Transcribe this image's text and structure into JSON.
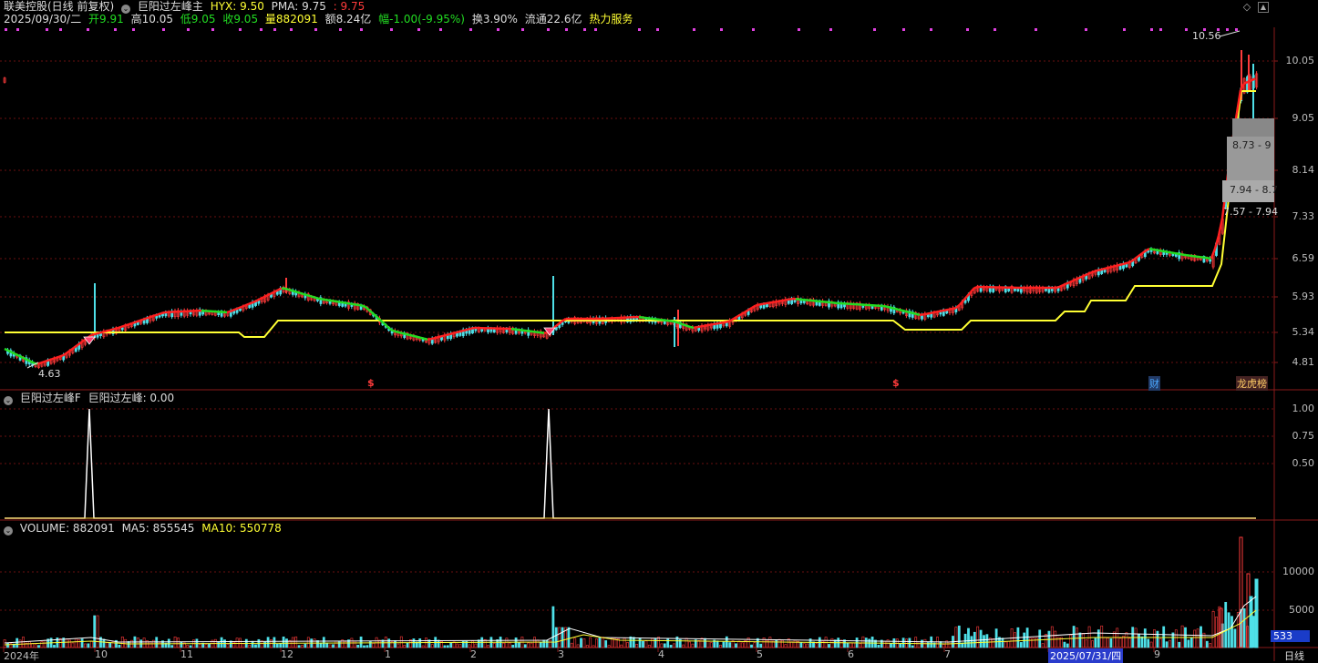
{
  "header": {
    "stock_name": "联美控股(日线 前复权)",
    "indicator_name": "巨阳过左峰主",
    "hyx_label": "HYX: 9.50",
    "pma_label": "PMA: 9.75",
    "pma2_label": ": 9.75",
    "date": "2025/09/30/二",
    "open": "开9.91",
    "high": "高10.05",
    "low": "低9.05",
    "close": "收9.05",
    "volume": "量882091",
    "amount": "额8.24亿",
    "change": "幅-1.00(-9.95%)",
    "turnover": "换3.90%",
    "float": "流通22.6亿",
    "service": "热力服务"
  },
  "colors": {
    "up": "#ff3b3b",
    "down": "#4ee0e8",
    "support": "#ffff33",
    "ma_red": "#ff2020",
    "ma_green": "#22dd22",
    "grid": "#6a1010",
    "magenta": "#e040e0"
  },
  "price_axis": {
    "ticks": [
      "10.05",
      "9.05",
      "8.14",
      "7.33",
      "6.59",
      "5.93",
      "5.34",
      "4.81"
    ]
  },
  "price_annotations": {
    "high_label": "10.56",
    "low_label": "4.63",
    "range1": "8.73 - 9",
    "range2": "7.94 - 8.7",
    "range3": "7.57 - 7.94"
  },
  "markers": {
    "dollar": "$",
    "cai": "财",
    "longhu": "龙虎榜"
  },
  "sub1": {
    "title": "巨阳过左峰F",
    "value_label": "巨阳过左峰: 0.00",
    "ticks": [
      "1.00",
      "0.75",
      "0.50"
    ]
  },
  "sub2": {
    "title": "VOLUME: 882091",
    "ma5": "MA5: 855545",
    "ma10": "MA10: 550778",
    "ticks": [
      "10000",
      "5000"
    ],
    "unit_badge": "533"
  },
  "xaxis": {
    "labels": [
      "2024年",
      "10",
      "11",
      "12",
      "1",
      "2",
      "3",
      "4",
      "5",
      "6",
      "7",
      "2025/07/31/四",
      "9"
    ],
    "period": "日线"
  },
  "chart_data": [
    {
      "type": "line",
      "title": "巨阳过左峰F",
      "series": [
        {
          "name": "巨阳过左峰",
          "values": [
            0,
            1,
            0,
            1,
            0
          ]
        }
      ],
      "x": [
        "2024/10",
        "2024/10",
        "2025/02",
        "2025/03",
        "2025/09"
      ],
      "ylim": [
        0,
        1
      ]
    },
    {
      "type": "bar",
      "title": "VOLUME",
      "series": [
        {
          "name": "VOLUME",
          "values": [
            882091
          ]
        },
        {
          "name": "MA5",
          "values": [
            855545
          ]
        },
        {
          "name": "MA10",
          "values": [
            550778
          ]
        }
      ]
    }
  ]
}
